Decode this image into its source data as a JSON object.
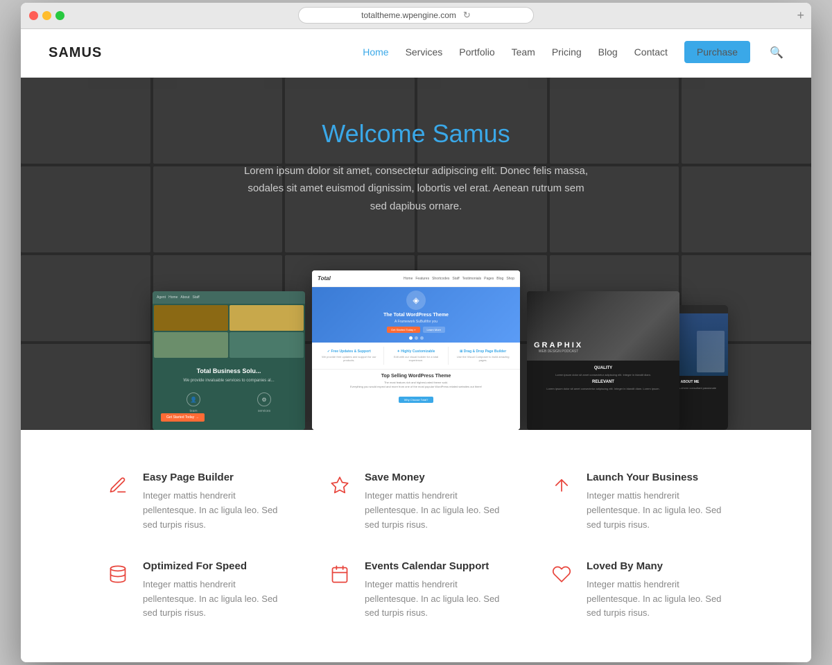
{
  "browser": {
    "url": "totaltheme.wpengine.com"
  },
  "navbar": {
    "brand": "SAMUS",
    "nav_items": [
      {
        "label": "Home",
        "active": true
      },
      {
        "label": "Services",
        "active": false
      },
      {
        "label": "Portfolio",
        "active": false
      },
      {
        "label": "Team",
        "active": false
      },
      {
        "label": "Pricing",
        "active": false
      },
      {
        "label": "Blog",
        "active": false
      },
      {
        "label": "Contact",
        "active": false
      }
    ],
    "purchase_label": "Purchase"
  },
  "hero": {
    "title": "Welcome Samus",
    "description": "Lorem ipsum dolor sit amet, consectetur adipiscing elit. Donec felis massa, sodales sit amet euismod dignissim, lobortis vel erat. Aenean rutrum sem sed dapibus ornare."
  },
  "mockup": {
    "main_logo": "Total",
    "main_hero_text": "The Total WordPress Theme",
    "main_hero_subtext": "A Framework Built for You",
    "main_hero_btn": "Get Started Today »",
    "features": [
      {
        "icon": "✓",
        "title": "Free Updates & Support",
        "text": "We provide free updates and support for our products."
      },
      {
        "icon": "✓",
        "title": "Highly Customizable",
        "text": "Edit in our visual builder for a total experience."
      },
      {
        "icon": "✓",
        "title": "Drag & Drop Page Builder",
        "text": "Use the Visual Composer to build amazing pages."
      }
    ],
    "main_bottom_title": "Top Selling WordPress Theme",
    "main_bottom_desc": "The most feature-rich and highest-rated theme sold. Everything you would expect and more from one of the most popular WordPress related websites out there!",
    "main_bottom_btn": "Why Choose Total?",
    "left_title": "Total Business Solu...",
    "left_subtitle": "We provide invaluable services to companies al...",
    "left_btn": "Get Started Today →",
    "right_brand": "GRAPHIX",
    "right_tagline": "WEB DESIGN PODCAST"
  },
  "features": [
    {
      "id": "easy-page-builder",
      "icon_type": "pencil",
      "icon_unicode": "✏",
      "title": "Easy Page Builder",
      "description": "Integer mattis hendrerit pellentesque. In ac ligula leo. Sed sed turpis risus."
    },
    {
      "id": "save-money",
      "icon_type": "diamond",
      "icon_unicode": "◆",
      "title": "Save Money",
      "description": "Integer mattis hendrerit pellentesque. In ac ligula leo. Sed sed turpis risus."
    },
    {
      "id": "launch-business",
      "icon_type": "rocket",
      "icon_unicode": "▲",
      "title": "Launch Your Business",
      "description": "Integer mattis hendrerit pellentesque. In ac ligula leo. Sed sed turpis risus."
    },
    {
      "id": "optimized-speed",
      "icon_type": "database",
      "icon_unicode": "⊚",
      "title": "Optimized For Speed",
      "description": "Integer mattis hendrerit pellentesque. In ac ligula leo. Sed sed turpis risus."
    },
    {
      "id": "events-calendar",
      "icon_type": "calendar",
      "icon_unicode": "▦",
      "title": "Events Calendar Support",
      "description": "Integer mattis hendrerit pellentesque. In ac ligula leo. Sed sed turpis risus."
    },
    {
      "id": "loved-by-many",
      "icon_type": "heart",
      "icon_unicode": "♥",
      "title": "Loved By Many",
      "description": "Integer mattis hendrerit pellentesque. In ac ligula leo. Sed sed turpis risus."
    }
  ],
  "colors": {
    "accent_blue": "#3aa8e8",
    "accent_red": "#e8453c",
    "nav_active": "#3aa8e8",
    "purchase_bg": "#3aa8e8"
  }
}
